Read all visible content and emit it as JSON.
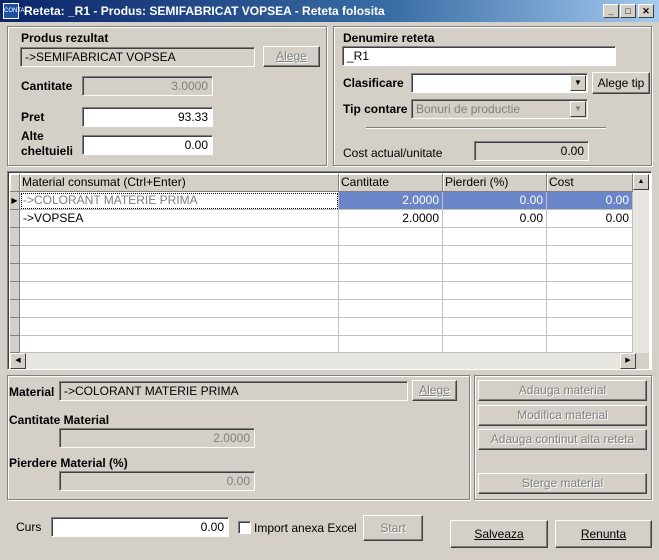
{
  "window": {
    "title": "Reteta: _R1  - Produs: SEMIFABRICAT VOPSEA - Reteta folosita",
    "icon_label": "CONTA"
  },
  "produs": {
    "label": "Produs rezultat",
    "value": "->SEMIFABRICAT VOPSEA",
    "alege_label": "Alege",
    "cantitate_label": "Cantitate",
    "cantitate_value": "3.0000",
    "pret_label": "Pret",
    "pret_value": "93.33",
    "alte_label_1": "Alte",
    "alte_label_2": "cheltuieli",
    "alte_value": "0.00"
  },
  "reteta": {
    "denumire_label": "Denumire reteta",
    "denumire_value": "_R1",
    "clasificare_label": "Clasificare",
    "clasificare_value": "",
    "alege_tip_label": "Alege tip",
    "tip_contare_label": "Tip contare",
    "tip_contare_value": "Bonuri de productie",
    "cost_label": "Cost actual/unitate",
    "cost_value": "0.00"
  },
  "grid": {
    "columns": [
      "Material consumat (Ctrl+Enter)",
      "Cantitate",
      "Pierderi (%)",
      "Cost"
    ],
    "rows": [
      {
        "material": "->COLORANT MATERIE PRIMA",
        "cantitate": "2.0000",
        "pierderi": "0.00",
        "cost": "0.00"
      },
      {
        "material": "->VOPSEA",
        "cantitate": "2.0000",
        "pierderi": "0.00",
        "cost": "0.00"
      }
    ]
  },
  "material": {
    "label": "Material",
    "value": "->COLORANT MATERIE PRIMA",
    "alege_label": "Alege",
    "cantitate_label": "Cantitate Material",
    "cantitate_value": "2.0000",
    "pierdere_label": "Pierdere Material (%)",
    "pierdere_value": "0.00"
  },
  "actions": {
    "adauga": "Adauga material",
    "modifica": "Modifica material",
    "adauga_continut": "Adauga continut alta reteta",
    "sterge": "Sterge  material"
  },
  "footer": {
    "curs_label": "Curs",
    "curs_value": "0.00",
    "import_label": "Import anexa Excel",
    "start_label": "Start",
    "salveaza_label": "Salveaza",
    "renunta_label": "Renunta"
  },
  "colors": {
    "titlebar_start": "#0a246a",
    "selection": "#6a86c8"
  }
}
